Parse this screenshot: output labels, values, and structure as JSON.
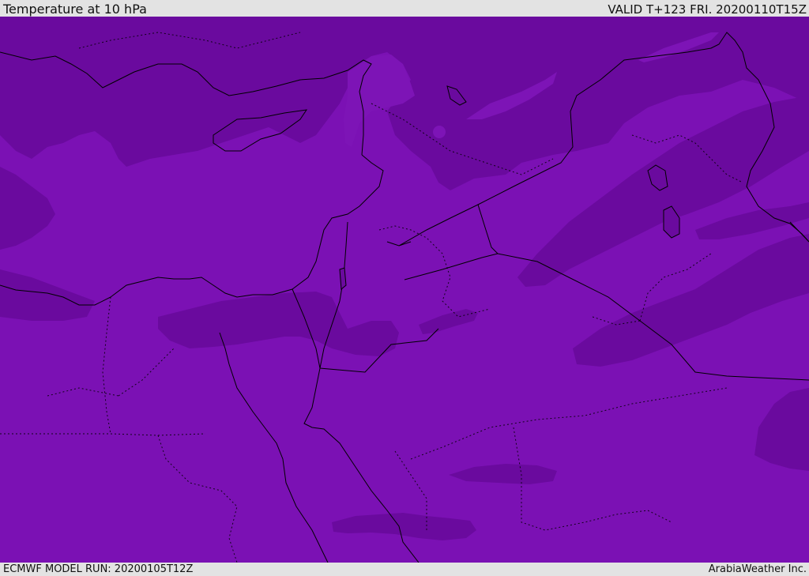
{
  "header": {
    "title": "Temperature at 10 hPa",
    "valid": "VALID T+123 FRI. 20200110T15Z"
  },
  "footer": {
    "model_run": "ECMWF MODEL RUN: 20200105T12Z",
    "brand": "ArabiaWeather Inc."
  },
  "map": {
    "field_colors": {
      "base": "#7b11b4",
      "darker": "#6a0a9e",
      "lighter": "#8b22c6"
    },
    "line_color": "#000000"
  }
}
